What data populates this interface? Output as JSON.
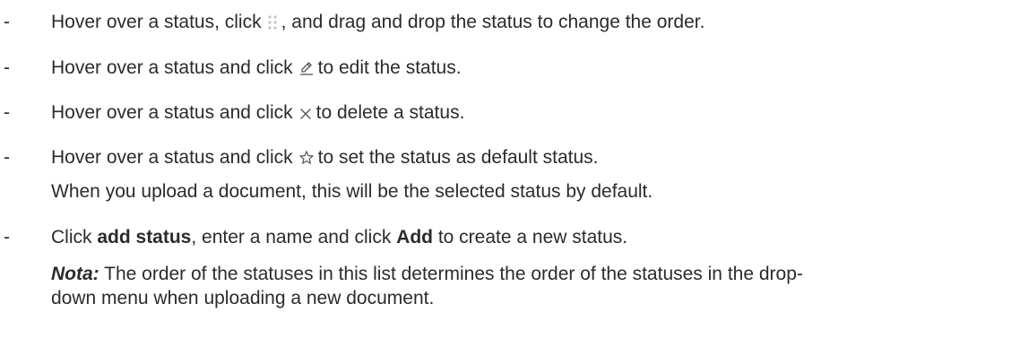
{
  "bullet_marker": "-",
  "items": [
    {
      "before": "Hover over a status, click",
      "icon": "drag-handle-icon",
      "after": ", and drag and drop the status to change the order."
    },
    {
      "before": "Hover over a status and click",
      "icon": "pencil-icon",
      "after": "to edit the status."
    },
    {
      "before": "Hover over a status and click",
      "icon": "close-icon",
      "after": "to delete a status."
    },
    {
      "before": "Hover over a status and click",
      "icon": "star-icon",
      "after": "to set the status as default status.",
      "continuation": "When you upload a document, this will be the selected status by default."
    },
    {
      "text_1": "Click ",
      "bold_1": "add status",
      "text_2": ", enter a name and click ",
      "bold_2": "Add",
      "text_3": " to create a new status."
    }
  ],
  "note": {
    "label": "Nota:",
    "line_1": " The order of the statuses in this list determines the order of the statuses in the drop-",
    "line_2": "down menu when uploading a new document."
  },
  "colors": {
    "text": "#2b2b2b",
    "icon_light": "#c4c4c4",
    "icon": "#555555"
  }
}
